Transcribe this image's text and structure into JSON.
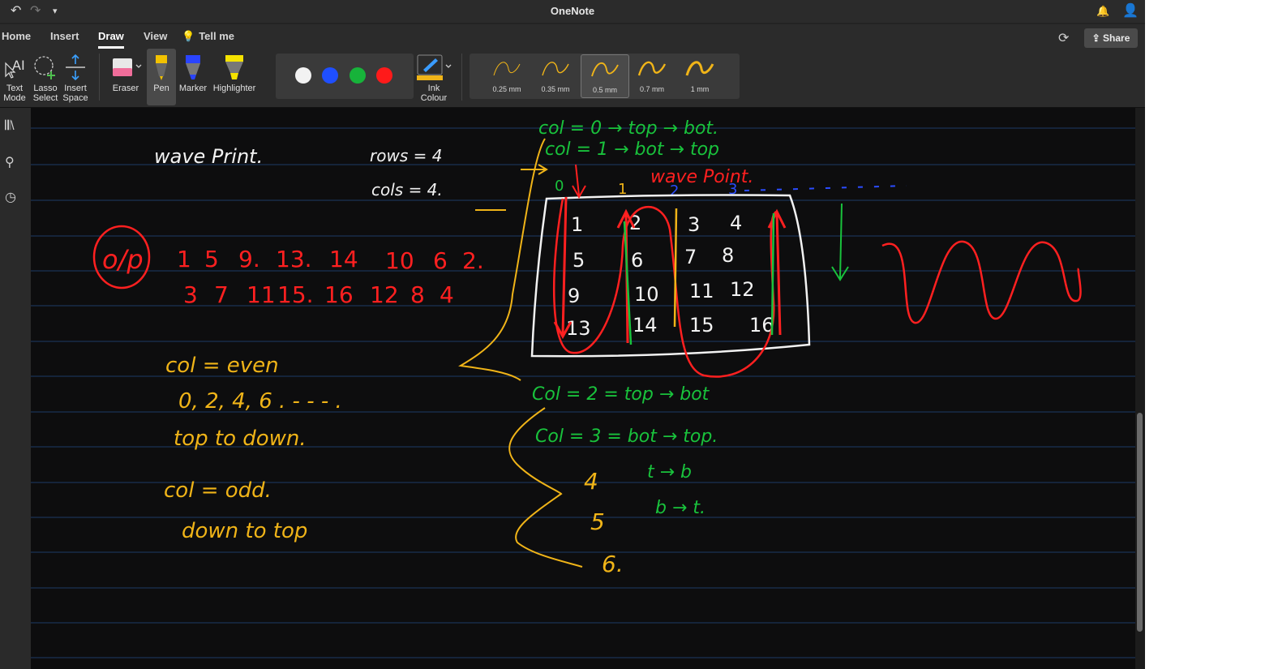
{
  "window": {
    "title": "OneNote"
  },
  "ribbon_tabs": [
    "Home",
    "Insert",
    "Draw",
    "View",
    "Tell me"
  ],
  "active_tab": "Draw",
  "share_label": "Share",
  "tools": {
    "text_mode": [
      "Text",
      "Mode"
    ],
    "lasso_select": [
      "Lasso",
      "Select"
    ],
    "insert_space": [
      "Insert",
      "Space"
    ],
    "eraser": "Eraser",
    "pen": "Pen",
    "marker": "Marker",
    "highlighter": "Highlighter",
    "ink_colour": [
      "Ink",
      "Colour"
    ]
  },
  "pen_colors": [
    "#f2f2f2",
    "#1f4fff",
    "#17b33a",
    "#ff1a1a"
  ],
  "thicknesses": [
    "0.25 mm",
    "0.35 mm",
    "0.5 mm",
    "0.7 mm",
    "1 mm"
  ],
  "selected_thickness": "0.5 mm",
  "ink_colors": {
    "yellow": "#f0b418",
    "green": "#19c23c",
    "red": "#ff2020",
    "white": "#f2f2f2",
    "blue": "#2b4cff"
  },
  "notes": {
    "heading": "wave Print.",
    "rows_eq": "rows = 4",
    "cols_eq": "cols = 4.",
    "op_label": "o/p",
    "output_line1": [
      "1",
      "5",
      "9.",
      "13.",
      "14",
      "10",
      "6",
      "2."
    ],
    "output_line2": [
      "3",
      "7",
      "11",
      "15.",
      "16",
      "12",
      "8",
      "4"
    ],
    "rule_even_1": "col = even",
    "rule_even_2": "0, 2, 4, 6 . - - - .",
    "rule_even_3": "top to down.",
    "rule_odd_1": "col = odd.",
    "rule_odd_2": "down to top",
    "col0": "col = 0 → top → bot.",
    "col1": "col = 1 → bot → top",
    "wave_point": "wave Point.",
    "col_indices": [
      "0",
      "1",
      "2",
      "3"
    ],
    "matrix": [
      [
        "1",
        "2",
        "3",
        "4"
      ],
      [
        "5",
        "6",
        "7",
        "8"
      ],
      [
        "9",
        "10",
        "11",
        "12"
      ],
      [
        "13",
        "14",
        "15",
        "16"
      ]
    ],
    "col2": "Col = 2 = top → bot",
    "col3": "Col = 3 = bot → top.",
    "c4": "4",
    "c4_rule": "t → b",
    "c5": "5",
    "c5_rule": "b → t.",
    "c6": "6."
  }
}
